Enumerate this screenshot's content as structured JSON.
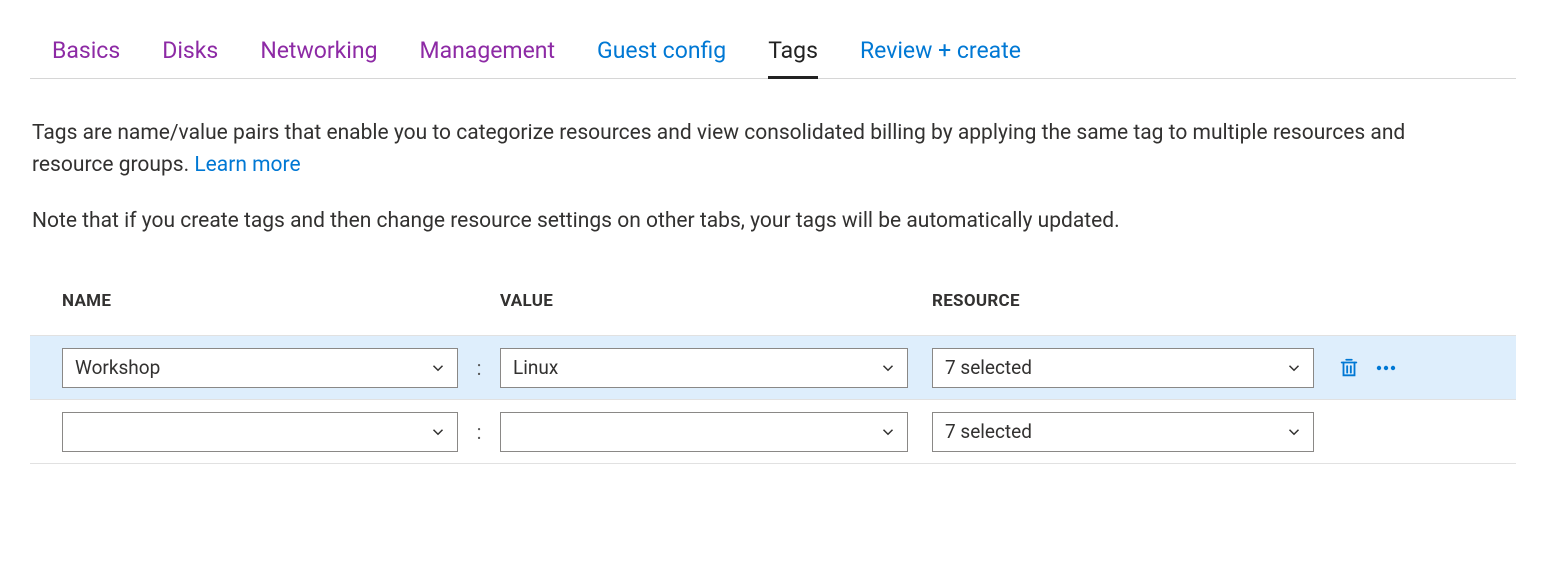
{
  "tabs": {
    "items": [
      {
        "label": "Basics",
        "state": "visited"
      },
      {
        "label": "Disks",
        "state": "visited"
      },
      {
        "label": "Networking",
        "state": "visited"
      },
      {
        "label": "Management",
        "state": "visited"
      },
      {
        "label": "Guest config",
        "state": "link"
      },
      {
        "label": "Tags",
        "state": "active"
      },
      {
        "label": "Review + create",
        "state": "link"
      }
    ]
  },
  "description": {
    "text": "Tags are name/value pairs that enable you to categorize resources and view consolidated billing by applying the same tag to multiple resources and resource groups.  ",
    "learn_more": "Learn more"
  },
  "note": "Note that if you create tags and then change resource settings on other tabs, your tags will be automatically updated.",
  "table": {
    "headers": {
      "name": "NAME",
      "value": "VALUE",
      "resource": "RESOURCE"
    },
    "colon": ":",
    "rows": [
      {
        "name": "Workshop",
        "value": "Linux",
        "resource": "7 selected",
        "selected": true
      },
      {
        "name": "",
        "value": "",
        "resource": "7 selected",
        "selected": false
      }
    ]
  },
  "colors": {
    "accent": "#0078d4",
    "visited": "#8d2aa5",
    "row_selected": "#deeefc",
    "icon_blue": "#0078d4"
  }
}
